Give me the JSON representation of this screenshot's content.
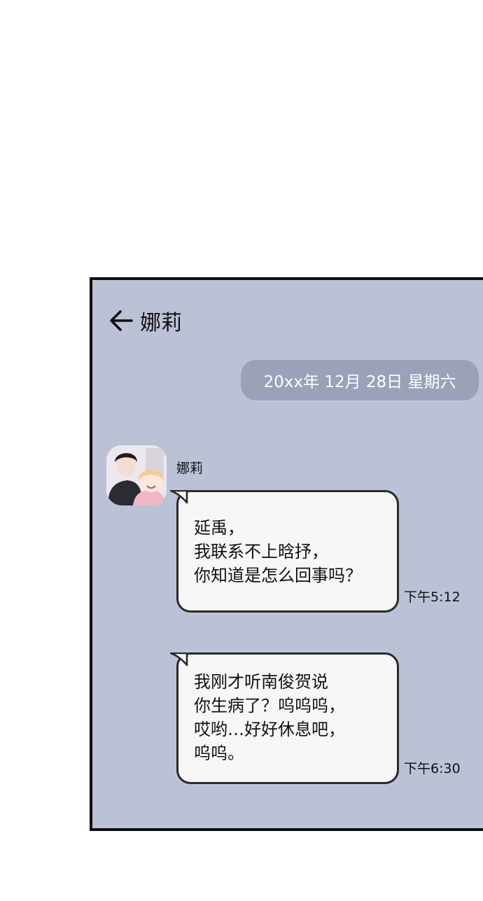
{
  "chat": {
    "title": "娜莉",
    "date_label": "20xx年 12月 28日 星期六",
    "sender_name": "娜莉",
    "messages": [
      {
        "lines": [
          "延禹，",
          "我联系不上晗抒，",
          "你知道是怎么回事吗？"
        ],
        "time": "下午5:12"
      },
      {
        "lines": [
          "我刚才听南俊贺说",
          "你生病了？呜呜呜，",
          "哎哟…好好休息吧，",
          "呜呜。"
        ],
        "time": "下午6:30"
      }
    ]
  },
  "colors": {
    "panel_bg": "#bcc2d6",
    "date_pill_bg": "#9aa1b9",
    "bubble_bg": "#f7f7f7",
    "border": "#0d0d0d"
  },
  "icons": {
    "back": "arrow-left-icon",
    "avatar": "contact-avatar"
  }
}
